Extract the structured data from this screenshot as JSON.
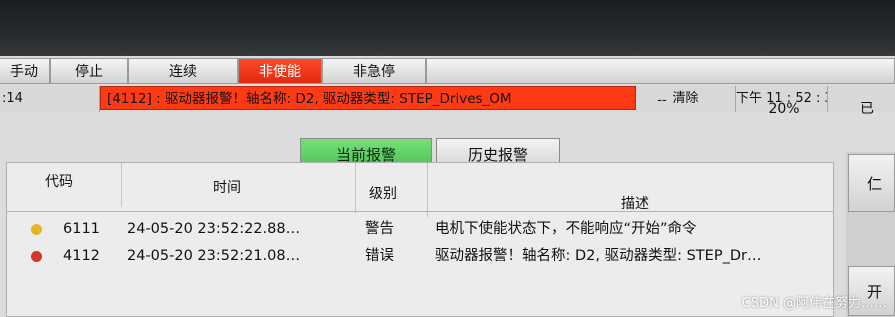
{
  "buttons": {
    "manual": "手动",
    "stop": "停止",
    "continuous": "连续",
    "disable": "非使能",
    "non_emergency_stop": "非急停"
  },
  "status": {
    "left_value": ":14",
    "alarm_message": "[4112] :   驱动器报警！轴名称: D2, 驱动器类型: STEP_Drives_OM",
    "dash1": "--",
    "dash2": "--",
    "percent": "20%",
    "right_status": "已",
    "clear_label": "清除",
    "clock": "下午 11 : 52 : 3"
  },
  "tabs": {
    "current_alarm": "当前报警",
    "history_alarm": "历史报警"
  },
  "table": {
    "headers": {
      "code": "代码",
      "time": "时间",
      "level": "级别",
      "description": "描述"
    },
    "rows": [
      {
        "code": "6111",
        "time": "24-05-20 23:52:22.88…",
        "level": "警告",
        "description": "电机下使能状态下，不能响应“开始”命令",
        "dot_color": "#e3b62a"
      },
      {
        "code": "4112",
        "time": "24-05-20 23:52:21.08…",
        "level": "错误",
        "description": "驱动器报警！轴名称: D2, 驱动器类型: STEP_Dr…",
        "dot_color": "#d8352a"
      }
    ]
  },
  "right_panel": {
    "top_label": "仁",
    "bottom_label": "开"
  },
  "watermark": "CSDN @阿伟在努力……",
  "colors": {
    "accent_red": "#ff3b16",
    "accent_green": "#4cc253"
  }
}
